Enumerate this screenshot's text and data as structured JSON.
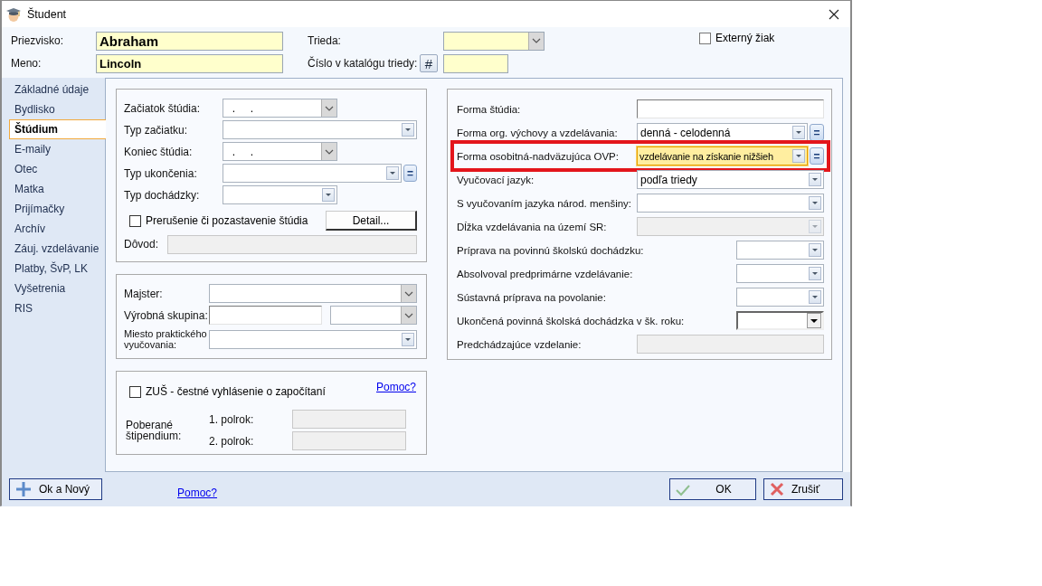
{
  "window": {
    "title": "Študent"
  },
  "header": {
    "surname": {
      "label": "Priezvisko:",
      "value": "Abraham"
    },
    "first_name": {
      "label": "Meno:",
      "value": "Lincoln"
    },
    "class": {
      "label": "Trieda:"
    },
    "catalog_number": {
      "label": "Číslo v katalógu triedy:",
      "button": "#"
    },
    "external": {
      "label": "Externý žiak",
      "checked": false
    }
  },
  "sidebar": {
    "items": [
      {
        "label": "Základné údaje",
        "selected": false
      },
      {
        "label": "Bydlisko",
        "selected": false
      },
      {
        "label": "Štúdium",
        "selected": true
      },
      {
        "label": "E-maily",
        "selected": false
      },
      {
        "label": "Otec",
        "selected": false
      },
      {
        "label": "Matka",
        "selected": false
      },
      {
        "label": "Prijímačky",
        "selected": false
      },
      {
        "label": "Archív",
        "selected": false
      },
      {
        "label": "Záuj. vzdelávanie",
        "selected": false
      },
      {
        "label": "Platby, ŠvP, LK",
        "selected": false
      },
      {
        "label": "Vyšetrenia",
        "selected": false
      },
      {
        "label": "RIS",
        "selected": false
      }
    ]
  },
  "study_box": {
    "fields": [
      {
        "label": "Začiatok štúdia:",
        "kind": "date",
        "value": "  .     ."
      },
      {
        "label": "Typ začiatku:",
        "kind": "combo"
      },
      {
        "label": "Koniec štúdia:",
        "kind": "date",
        "value": "  .     ."
      },
      {
        "label": "Typ ukončenia:",
        "kind": "combo",
        "equals_button": "="
      },
      {
        "label": "Typ dochádzky:",
        "kind": "combo"
      }
    ],
    "interruption": {
      "label": "Prerušenie či pozastavenie štúdia",
      "checked": false
    },
    "detail_button": "Detail...",
    "reason": {
      "label": "Dôvod:",
      "disabled": true
    }
  },
  "practice_box": {
    "master": {
      "label": "Majster:"
    },
    "group": {
      "label": "Výrobná skupina:"
    },
    "place": {
      "label": "Miesto praktického vyučovania:"
    }
  },
  "zus_box": {
    "checkbox": {
      "label": "ZUŠ - čestné vyhlásenie o započítaní",
      "checked": false
    },
    "help_link": "Pomoc?",
    "stipend_label": "Poberané štipendium:",
    "terms": [
      {
        "label": "1. polrok:",
        "disabled": true
      },
      {
        "label": "2. polrok:",
        "disabled": true
      }
    ]
  },
  "right_box": {
    "fields": [
      {
        "label": "Forma štúdia:",
        "kind": "text",
        "disabled": false,
        "focused": false,
        "highlighted": false
      },
      {
        "label": "Forma org. výchovy a vzdelávania:",
        "kind": "combo",
        "value": "denná - celodenná",
        "equals_button": "=",
        "disabled": false,
        "focused": false,
        "highlighted": false
      },
      {
        "label": "Forma osobitná-nadväzujúca OVP:",
        "kind": "combo",
        "value": "vzdelávanie na získanie nižšieh",
        "equals_button": "=",
        "disabled": false,
        "focused": true,
        "highlighted": true
      },
      {
        "label": "Vyučovací jazyk:",
        "kind": "combo",
        "value": "podľa triedy",
        "disabled": false,
        "focused": false,
        "highlighted": false
      },
      {
        "label": "S vyučovaním jazyka národ. menšiny:",
        "kind": "combo",
        "disabled": false,
        "focused": false,
        "highlighted": false
      },
      {
        "label": "Dĺžka vzdelávania na území SR:",
        "kind": "combo",
        "disabled": true,
        "focused": false,
        "highlighted": false
      },
      {
        "label": "Príprava na povinnú školskú dochádzku:",
        "kind": "combo",
        "disabled": false,
        "focused": false,
        "highlighted": false
      },
      {
        "label": "Absolvoval predprimárne vzdelávanie:",
        "kind": "combo",
        "disabled": false,
        "focused": false,
        "highlighted": false
      },
      {
        "label": "Sústavná príprava na povolanie:",
        "kind": "combo",
        "disabled": false,
        "focused": false,
        "highlighted": false
      },
      {
        "label": "Ukončená povinná školská dochádzka v šk. roku:",
        "kind": "select",
        "disabled": false,
        "focused": false,
        "highlighted": false
      },
      {
        "label": "Predchádzajúce vzdelanie:",
        "kind": "text",
        "disabled": true,
        "focused": false,
        "highlighted": false
      }
    ]
  },
  "footer": {
    "ok_new_button": "Ok a Nový",
    "help_link": "Pomoc?",
    "ok_button": "OK",
    "cancel_button": "Zrušiť"
  }
}
